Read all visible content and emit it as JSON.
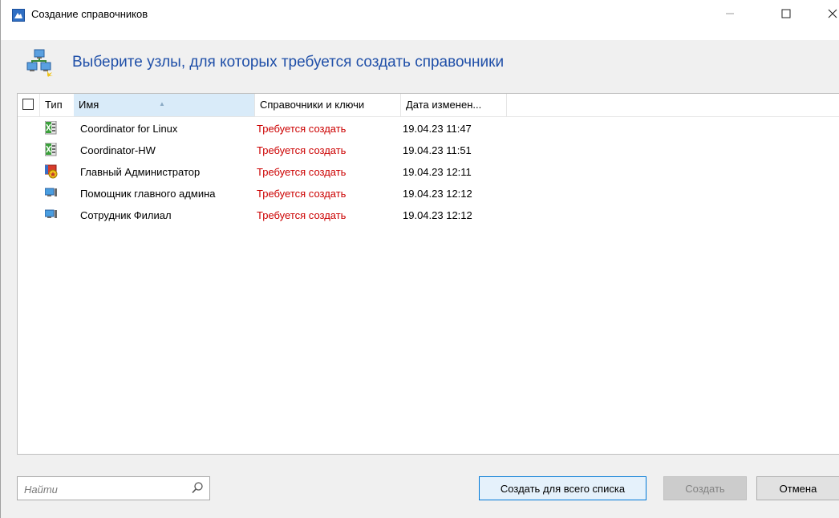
{
  "window": {
    "title": "Создание справочников",
    "minimize_label": "—",
    "maximize_label": "☐",
    "close_label": "✕"
  },
  "header": {
    "text": "Выберите узлы, для которых требуется создать справочники"
  },
  "columns": {
    "type": "Тип",
    "name": "Имя",
    "keys": "Справочники и ключи",
    "date": "Дата изменен..."
  },
  "rows": [
    {
      "icon": "coordinator-icon",
      "name": "Coordinator for Linux",
      "status": "Требуется создать",
      "date": "19.04.23 11:47"
    },
    {
      "icon": "coordinator-icon",
      "name": "Coordinator-HW",
      "status": "Требуется создать",
      "date": "19.04.23 11:51"
    },
    {
      "icon": "admin-icon",
      "name": "Главный Администратор",
      "status": "Требуется создать",
      "date": "19.04.23 12:11"
    },
    {
      "icon": "client-icon",
      "name": "Помощник главного админа",
      "status": "Требуется создать",
      "date": "19.04.23 12:12"
    },
    {
      "icon": "client-icon",
      "name": "Сотрудник Филиал",
      "status": "Требуется создать",
      "date": "19.04.23 12:12"
    }
  ],
  "search": {
    "placeholder": "Найти"
  },
  "buttons": {
    "create_all": "Создать для всего списка",
    "create": "Создать",
    "cancel": "Отмена"
  },
  "colors": {
    "header_text": "#1f4fa8",
    "status_text": "#cc0000",
    "sorted_column": "#d9ebf9"
  }
}
